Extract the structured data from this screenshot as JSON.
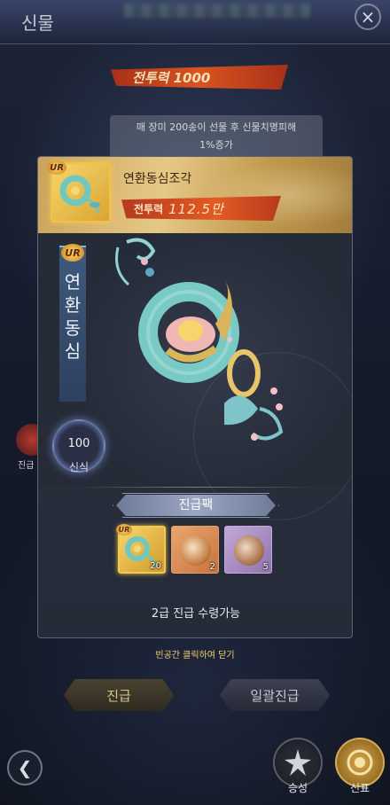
{
  "screen": {
    "title": "신물",
    "close_icon": "×",
    "combat_power_banner": "전투력 1000",
    "info_text_line1": "매 장미 200송이 선물 후 신물치명피해",
    "info_text_line2": "1%증가",
    "side_icon_label": "진급"
  },
  "modal": {
    "item_name": "연환동심조각",
    "rarity": "UR",
    "power_label": "전투력",
    "power_value": "112.5만",
    "vertical_title": "연환동심",
    "level_number": "100",
    "level_label": "신식",
    "pack_title": "진급팩",
    "rewards": [
      {
        "name": "연환동심조각",
        "count": "20",
        "rarity": "UR"
      },
      {
        "name": "orange-coin",
        "count": "2"
      },
      {
        "name": "purple-coin",
        "count": "5"
      }
    ],
    "claimable_text": "2급 진급 수령가능"
  },
  "close_hint": "빈공간 클릭하여 닫기",
  "buttons": {
    "advance": "진급",
    "bulk_advance": "일괄진급",
    "awaken": "승성",
    "ticket": "신표"
  },
  "colors": {
    "gold_accent": "#f0c24a",
    "power_red": "#d9551f",
    "hint_yellow": "#f2d36a"
  }
}
